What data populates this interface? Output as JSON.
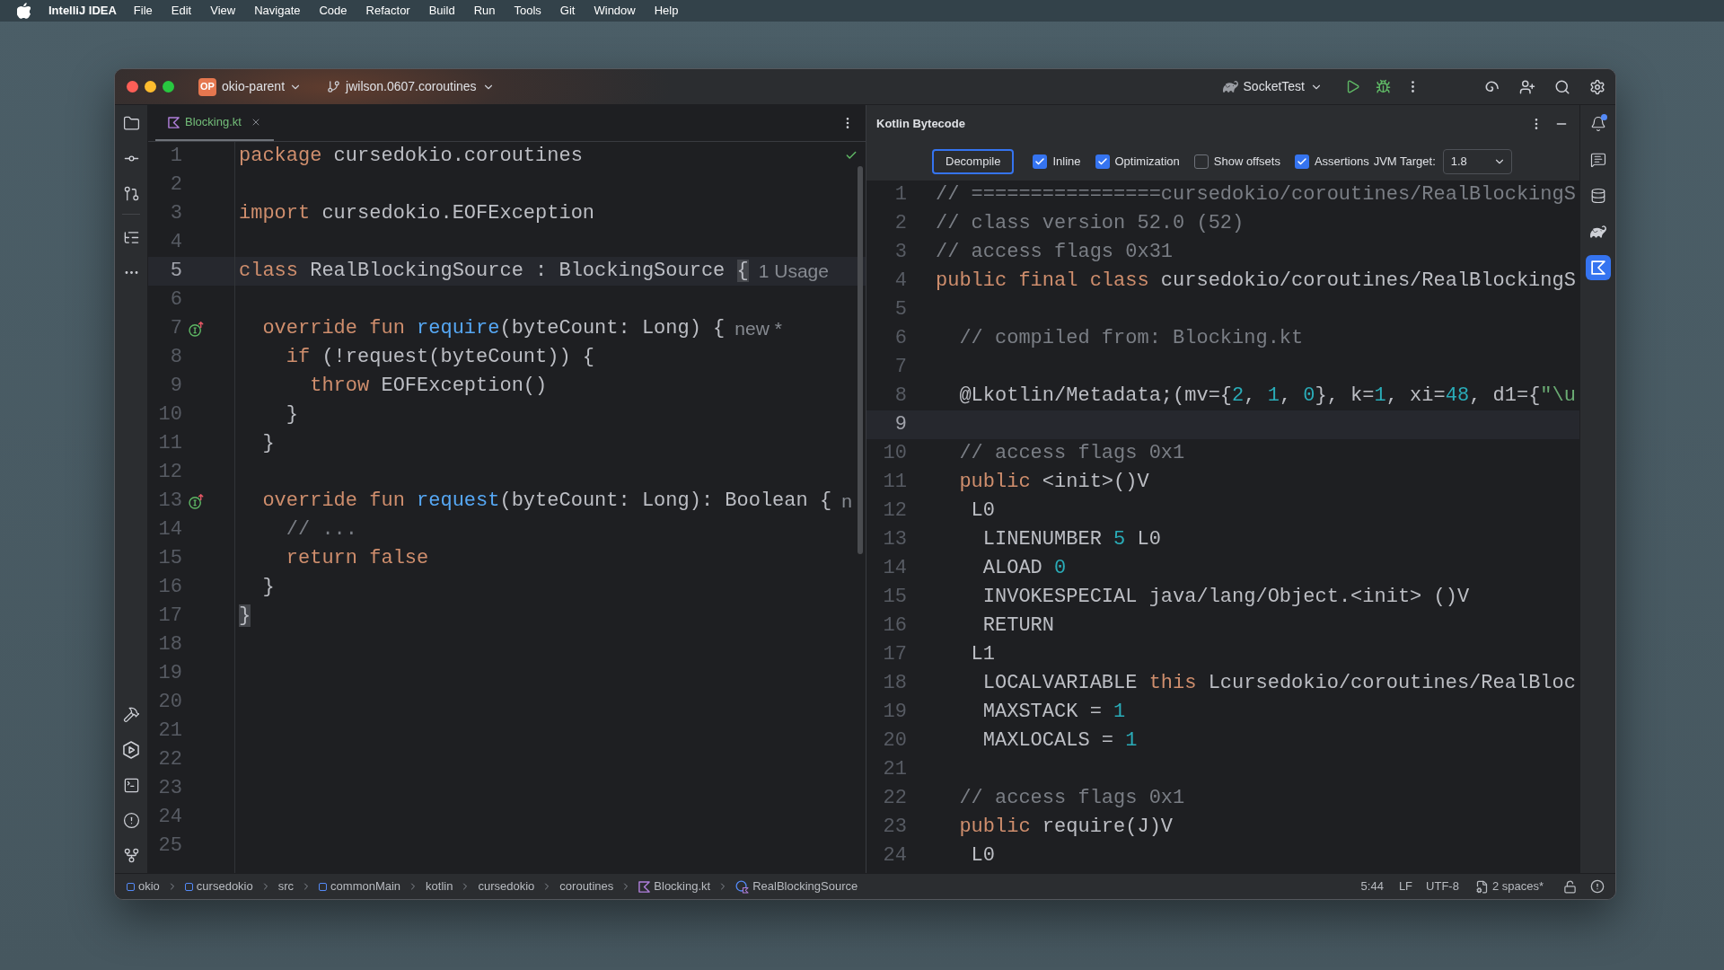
{
  "menu_bar": {
    "app_name": "IntelliJ IDEA",
    "items": [
      "File",
      "Edit",
      "View",
      "Navigate",
      "Code",
      "Refactor",
      "Build",
      "Run",
      "Tools",
      "Git",
      "Window",
      "Help"
    ]
  },
  "title_bar": {
    "project_badge": "OP",
    "project": "okio-parent",
    "branch": "jwilson.0607.coroutines",
    "run_configuration": "SocketTest"
  },
  "editor": {
    "tabs": [
      {
        "label": "Blocking.kt",
        "selected": true,
        "added": true
      }
    ],
    "lines": [
      {
        "n": "1",
        "current": false,
        "mark": false,
        "code": [
          {
            "kind": "kw",
            "text": "package"
          },
          {
            "kind": "tx",
            "text": " cursedokio.coroutines"
          }
        ]
      },
      {
        "n": "2",
        "current": false,
        "mark": false
      },
      {
        "n": "3",
        "current": false,
        "mark": false,
        "code": [
          {
            "kind": "kw",
            "text": "import"
          },
          {
            "kind": "tx",
            "text": " cursedokio.EOFException"
          }
        ]
      },
      {
        "n": "4",
        "current": false,
        "mark": false
      },
      {
        "n": "5",
        "current": true,
        "mark": false,
        "code": [
          {
            "kind": "kw",
            "text": "class"
          },
          {
            "kind": "tx",
            "text": " RealBlockingSource : BlockingSource "
          },
          {
            "kind": "match",
            "text": "{"
          }
        ],
        "inlay": "1 Usage"
      },
      {
        "n": "6",
        "current": false,
        "mark": false
      },
      {
        "n": "7",
        "current": false,
        "mark": true,
        "code": [
          {
            "kind": "kw",
            "text": "  override fun "
          },
          {
            "kind": "fn",
            "text": "require"
          },
          {
            "kind": "tx",
            "text": "(byteCount: Long) {"
          }
        ],
        "inlay": "new *"
      },
      {
        "n": "8",
        "current": false,
        "mark": false,
        "code": [
          {
            "kind": "kw",
            "text": "    if"
          },
          {
            "kind": "tx",
            "text": " (!request(byteCount)) {"
          }
        ]
      },
      {
        "n": "9",
        "current": false,
        "mark": false,
        "code": [
          {
            "kind": "kw",
            "text": "      throw"
          },
          {
            "kind": "tx",
            "text": " EOFException()"
          }
        ]
      },
      {
        "n": "10",
        "current": false,
        "mark": false,
        "code": [
          {
            "kind": "tx",
            "text": "    }"
          }
        ]
      },
      {
        "n": "11",
        "current": false,
        "mark": false,
        "code": [
          {
            "kind": "tx",
            "text": "  }"
          }
        ]
      },
      {
        "n": "12",
        "current": false,
        "mark": false
      },
      {
        "n": "13",
        "current": false,
        "mark": true,
        "code": [
          {
            "kind": "kw",
            "text": "  override fun "
          },
          {
            "kind": "fn",
            "text": "request"
          },
          {
            "kind": "tx",
            "text": "(byteCount: Long): Boolean {"
          }
        ],
        "inlay": "n"
      },
      {
        "n": "14",
        "current": false,
        "mark": false,
        "code": [
          {
            "kind": "cm",
            "text": "    // ..."
          }
        ]
      },
      {
        "n": "15",
        "current": false,
        "mark": false,
        "code": [
          {
            "kind": "kw",
            "text": "    return false"
          }
        ]
      },
      {
        "n": "16",
        "current": false,
        "mark": false,
        "code": [
          {
            "kind": "tx",
            "text": "  }"
          }
        ]
      },
      {
        "n": "17",
        "current": false,
        "mark": false,
        "code": [
          {
            "kind": "match",
            "text": "}"
          }
        ]
      },
      {
        "n": "18",
        "current": false,
        "mark": false
      },
      {
        "n": "19",
        "current": false,
        "mark": false
      },
      {
        "n": "20",
        "current": false,
        "mark": false
      },
      {
        "n": "21",
        "current": false,
        "mark": false
      },
      {
        "n": "22",
        "current": false,
        "mark": false
      },
      {
        "n": "23",
        "current": false,
        "mark": false
      },
      {
        "n": "24",
        "current": false,
        "mark": false
      },
      {
        "n": "25",
        "current": false,
        "mark": false
      }
    ]
  },
  "bytecode_panel": {
    "title": "Kotlin Bytecode",
    "decompile_button": "Decompile",
    "options": [
      {
        "label": "Inline",
        "checked": true
      },
      {
        "label": "Optimization",
        "checked": true
      },
      {
        "label": "Show offsets",
        "checked": false
      },
      {
        "label": "Assertions",
        "checked": true
      }
    ],
    "jvm_target": {
      "label": "JVM Target:",
      "value": "1.8"
    },
    "lines": [
      {
        "n": "1",
        "current": false,
        "code": [
          {
            "kind": "cm",
            "text": "// ================cursedokio/coroutines/RealBlockingS"
          }
        ]
      },
      {
        "n": "2",
        "current": false,
        "code": [
          {
            "kind": "cm",
            "text": "// class version 52.0 (52)"
          }
        ]
      },
      {
        "n": "3",
        "current": false,
        "code": [
          {
            "kind": "cm",
            "text": "// access flags 0x31"
          }
        ]
      },
      {
        "n": "4",
        "current": false,
        "code": [
          {
            "kind": "kw",
            "text": "public final class"
          },
          {
            "kind": "tx",
            "text": " cursedokio/coroutines/RealBlockingS"
          }
        ]
      },
      {
        "n": "5",
        "current": false
      },
      {
        "n": "6",
        "current": false,
        "code": [
          {
            "kind": "cm",
            "text": "  // compiled from: Blocking.kt"
          }
        ]
      },
      {
        "n": "7",
        "current": false
      },
      {
        "n": "8",
        "current": false,
        "code": [
          {
            "kind": "tx",
            "text": "  @Lkotlin/Metadata;(mv={"
          },
          {
            "kind": "num",
            "text": "2"
          },
          {
            "kind": "tx",
            "text": ", "
          },
          {
            "kind": "num",
            "text": "1"
          },
          {
            "kind": "tx",
            "text": ", "
          },
          {
            "kind": "num",
            "text": "0"
          },
          {
            "kind": "tx",
            "text": "}, k="
          },
          {
            "kind": "num",
            "text": "1"
          },
          {
            "kind": "tx",
            "text": ", xi="
          },
          {
            "kind": "num",
            "text": "48"
          },
          {
            "kind": "tx",
            "text": ", d1={"
          },
          {
            "kind": "str",
            "text": "\"\\u"
          }
        ]
      },
      {
        "n": "9",
        "current": true
      },
      {
        "n": "10",
        "current": false,
        "code": [
          {
            "kind": "cm",
            "text": "  // access flags 0x1"
          }
        ]
      },
      {
        "n": "11",
        "current": false,
        "code": [
          {
            "kind": "kw",
            "text": "  public"
          },
          {
            "kind": "tx",
            "text": " <init>()V"
          }
        ]
      },
      {
        "n": "12",
        "current": false,
        "code": [
          {
            "kind": "tx",
            "text": "   L0"
          }
        ]
      },
      {
        "n": "13",
        "current": false,
        "code": [
          {
            "kind": "tx",
            "text": "    LINENUMBER "
          },
          {
            "kind": "num",
            "text": "5"
          },
          {
            "kind": "tx",
            "text": " L0"
          }
        ]
      },
      {
        "n": "14",
        "current": false,
        "code": [
          {
            "kind": "tx",
            "text": "    ALOAD "
          },
          {
            "kind": "num",
            "text": "0"
          }
        ]
      },
      {
        "n": "15",
        "current": false,
        "code": [
          {
            "kind": "tx",
            "text": "    INVOKESPECIAL java/lang/Object.<init> ()V"
          }
        ]
      },
      {
        "n": "16",
        "current": false,
        "code": [
          {
            "kind": "tx",
            "text": "    RETURN"
          }
        ]
      },
      {
        "n": "17",
        "current": false,
        "code": [
          {
            "kind": "tx",
            "text": "   L1"
          }
        ]
      },
      {
        "n": "18",
        "current": false,
        "code": [
          {
            "kind": "tx",
            "text": "    LOCALVARIABLE "
          },
          {
            "kind": "kw",
            "text": "this"
          },
          {
            "kind": "tx",
            "text": " Lcursedokio/coroutines/RealBloc"
          }
        ]
      },
      {
        "n": "19",
        "current": false,
        "code": [
          {
            "kind": "tx",
            "text": "    MAXSTACK = "
          },
          {
            "kind": "num",
            "text": "1"
          }
        ]
      },
      {
        "n": "20",
        "current": false,
        "code": [
          {
            "kind": "tx",
            "text": "    MAXLOCALS = "
          },
          {
            "kind": "num",
            "text": "1"
          }
        ]
      },
      {
        "n": "21",
        "current": false
      },
      {
        "n": "22",
        "current": false,
        "code": [
          {
            "kind": "cm",
            "text": "  // access flags 0x1"
          }
        ]
      },
      {
        "n": "23",
        "current": false,
        "code": [
          {
            "kind": "kw",
            "text": "  public"
          },
          {
            "kind": "tx",
            "text": " require(J)V"
          }
        ]
      },
      {
        "n": "24",
        "current": false,
        "code": [
          {
            "kind": "tx",
            "text": "   L0"
          }
        ]
      }
    ]
  },
  "right_toolbar": [
    {
      "kind": "notifications",
      "selected": false,
      "badge": true
    },
    {
      "kind": "chat",
      "selected": false,
      "badge": false
    },
    {
      "kind": "database",
      "selected": false,
      "badge": false
    },
    {
      "kind": "elephant",
      "selected": false,
      "badge": false
    },
    {
      "kind": "bytecode",
      "selected": true,
      "badge": false
    }
  ],
  "status_bar": {
    "breadcrumbs": [
      {
        "label": "okio",
        "kind": "module"
      },
      {
        "label": "cursedokio",
        "kind": "module"
      },
      {
        "label": "src",
        "kind": "folder"
      },
      {
        "label": "commonMain",
        "kind": "module"
      },
      {
        "label": "kotlin",
        "kind": "folder"
      },
      {
        "label": "cursedokio",
        "kind": "folder"
      },
      {
        "label": "coroutines",
        "kind": "folder"
      },
      {
        "label": "Blocking.kt",
        "kind": "file"
      },
      {
        "label": "RealBlockingSource",
        "kind": "class"
      }
    ],
    "caret": "5:44",
    "line_separator": "LF",
    "encoding": "UTF-8",
    "indent": "2 spaces*"
  }
}
